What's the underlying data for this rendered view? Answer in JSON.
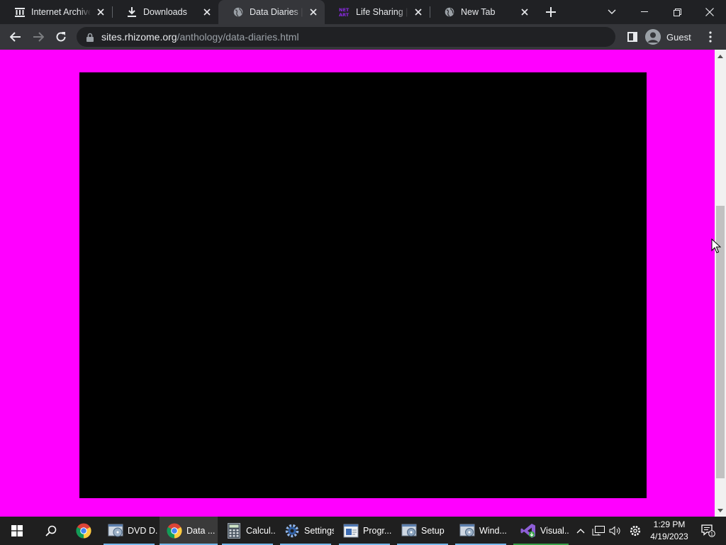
{
  "browser": {
    "tabs": [
      {
        "label": "Internet Archive: ...",
        "icon": "archive-icon",
        "active": false
      },
      {
        "label": "Downloads",
        "icon": "download-icon",
        "active": false
      },
      {
        "label": "Data Diaries | Net Art",
        "icon": "globe-icon",
        "active": true
      },
      {
        "label": "Life Sharing | Net Art",
        "icon": "net-art-icon",
        "active": false
      },
      {
        "label": "New Tab",
        "icon": "globe-icon",
        "active": false
      }
    ],
    "url_host": "sites.rhizome.org",
    "url_path": "/anthology/data-diaries.html",
    "profile_name": "Guest"
  },
  "page": {
    "background_color": "#ff00ff",
    "artwork_color": "#000000"
  },
  "taskbar": {
    "apps": [
      {
        "label": "",
        "icon": "chrome-icon"
      },
      {
        "label": "DVD D...",
        "icon": "dvd-installer-icon"
      },
      {
        "label": "Data ...",
        "icon": "chrome-icon",
        "active": true
      },
      {
        "label": "Calcul...",
        "icon": "calculator-icon"
      },
      {
        "label": "Settings",
        "icon": "settings-gear-icon"
      },
      {
        "label": "Progr...",
        "icon": "programs-icon"
      },
      {
        "label": "Setup",
        "icon": "setup-icon"
      },
      {
        "label": "Wind...",
        "icon": "windows-installer-icon"
      },
      {
        "label": "Visual...",
        "icon": "visual-studio-icon"
      }
    ],
    "time": "1:29 PM",
    "date": "4/19/2023",
    "notification_count": "1"
  }
}
